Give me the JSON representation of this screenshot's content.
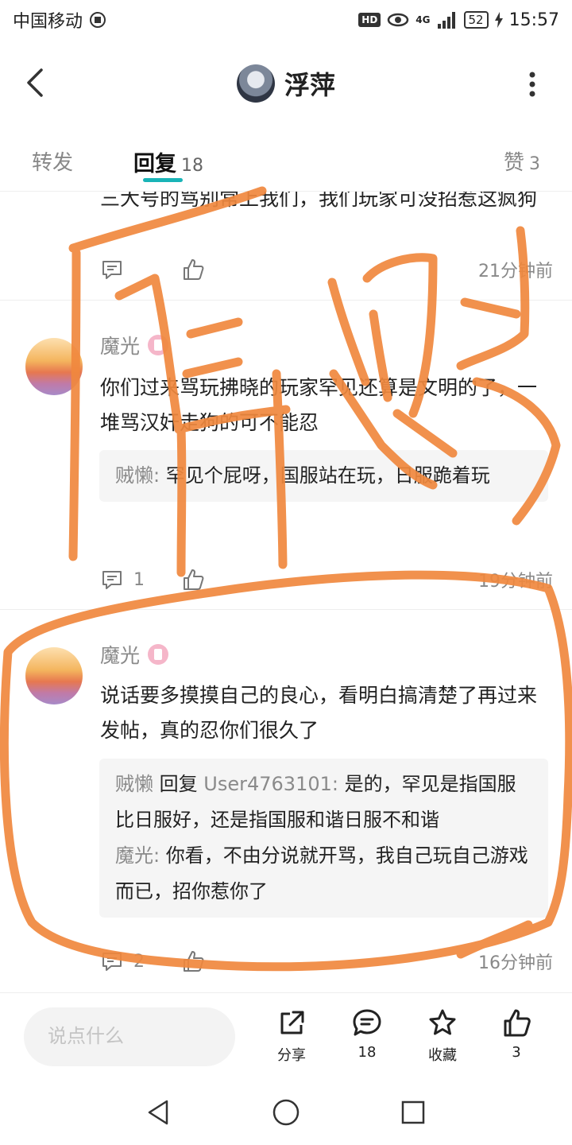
{
  "status_bar": {
    "carrier": "中国移动",
    "hd": "HD",
    "network": "4G",
    "battery": "52",
    "time": "15:57"
  },
  "header": {
    "title": "浮萍"
  },
  "tabs": {
    "forward": "转发",
    "reply": "回复",
    "reply_count": "18",
    "like": "赞",
    "like_count": "3"
  },
  "clipped_comment": {
    "text": "三大号的骂别常上我们，我们玩家可没招惹这疯狗",
    "reply_count": "",
    "time": "21分钟前"
  },
  "comments": [
    {
      "user": "魔光",
      "text": "你们过来骂玩拂晓的玩家罕见还算是文明的了，一堆骂汉奸走狗的可不能忍",
      "replies": [
        {
          "user": "贼懒",
          "reply_to": "",
          "text": "罕见个屁呀，国服站在玩，日服跪着玩"
        }
      ],
      "reply_count": "1",
      "time": "19分钟前"
    },
    {
      "user": "魔光",
      "text": "说话要多摸摸自己的良心，看明白搞清楚了再过来发帖，真的忍你们很久了",
      "replies": [
        {
          "user": "贼懒",
          "reply_word": "回复",
          "reply_to": "User4763101",
          "text": "是的，罕见是指国服比日服好，还是指国服和谐日服不和谐"
        },
        {
          "user": "魔光",
          "reply_to": "",
          "text": "你看，不由分说就开骂，我自己玩自己游戏而已，招你惹你了"
        }
      ],
      "reply_count": "2",
      "time": "16分钟前"
    }
  ],
  "bottom_bar": {
    "input_placeholder": "说点什么",
    "share_label": "分享",
    "comment_count": "18",
    "favorite_label": "收藏",
    "like_count": "3"
  },
  "colors": {
    "accent": "#19b4b7",
    "annotation": "#f0883e"
  }
}
